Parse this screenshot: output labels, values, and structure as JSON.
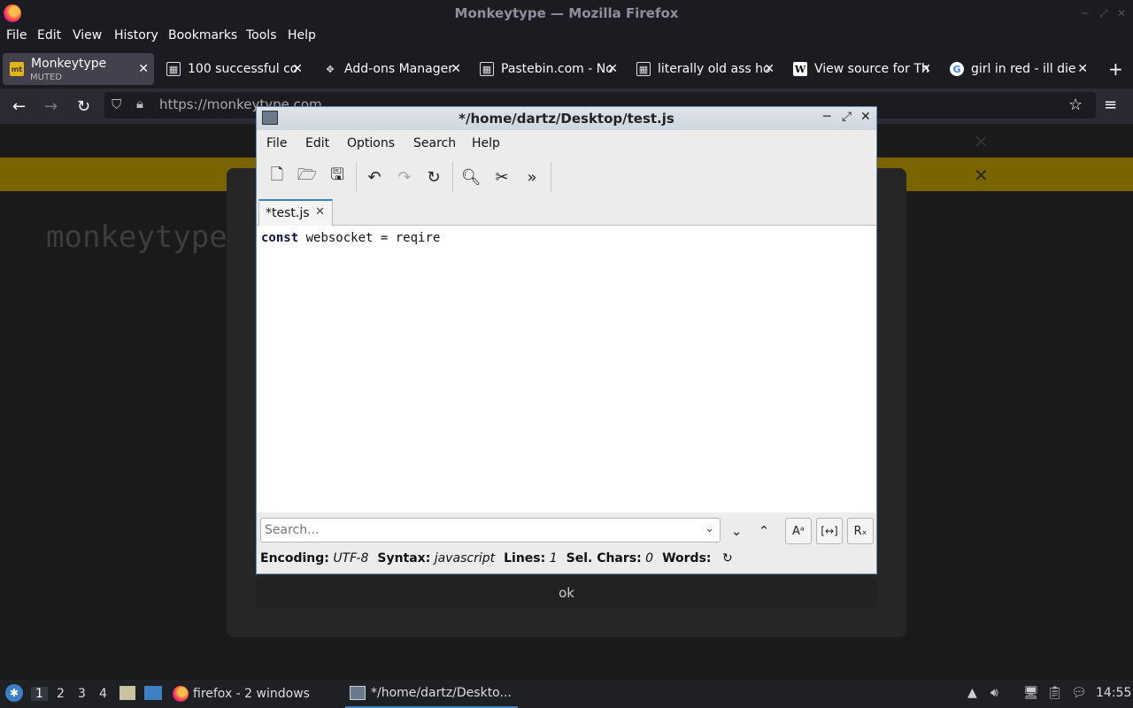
{
  "firefox": {
    "window_title": "Monkeytype — Mozilla Firefox",
    "menu": [
      "File",
      "Edit",
      "View",
      "History",
      "Bookmarks",
      "Tools",
      "Help"
    ],
    "tabs": [
      {
        "label": "Monkeytype",
        "sub": "MUTED",
        "icon": "monkeytype-favicon",
        "active": true
      },
      {
        "label": "100 successful co",
        "icon": "grid-favicon"
      },
      {
        "label": "Add-ons Manager",
        "icon": "puzzle-icon"
      },
      {
        "label": "Pastebin.com - No",
        "icon": "grid-favicon"
      },
      {
        "label": "literally old ass ho",
        "icon": "grid-favicon"
      },
      {
        "label": "View source for Th",
        "icon": "wikipedia-favicon"
      },
      {
        "label": "girl in red - ill die",
        "icon": "google-favicon"
      }
    ],
    "url": "https://monkeytype.com"
  },
  "page": {
    "logo": "monkeytype",
    "modal_ok": "ok"
  },
  "editor": {
    "title": "*/home/dartz/Desktop/test.js",
    "menu": [
      "File",
      "Edit",
      "Options",
      "Search",
      "Help"
    ],
    "tab_label": "*test.js",
    "code_kw": "const",
    "code_rest": " websocket = reqire",
    "search_placeholder": "Search...",
    "status": {
      "encoding_label": "Encoding:",
      "encoding": "UTF-8",
      "syntax_label": "Syntax:",
      "syntax": "javascript",
      "lines_label": "Lines:",
      "lines": "1",
      "selchars_label": "Sel. Chars:",
      "selchars": "0",
      "words_label": "Words:"
    }
  },
  "taskbar": {
    "workspaces": [
      "1",
      "2",
      "3",
      "4"
    ],
    "firefox_task": "firefox - 2 windows",
    "editor_task": "*/home/dartz/Deskto...",
    "clock": "14:55"
  }
}
